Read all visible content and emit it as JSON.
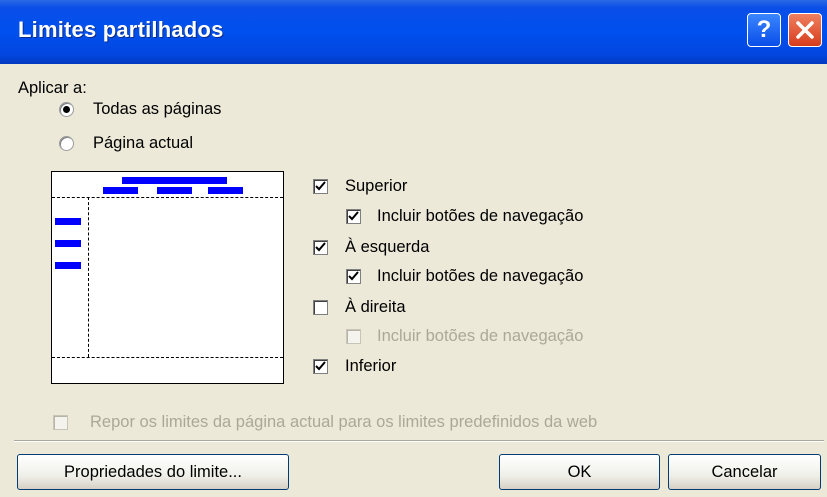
{
  "window": {
    "title": "Limites partilhados",
    "help_label": "?"
  },
  "apply_to": {
    "label": "Aplicar a:",
    "options": [
      {
        "label": "Todas as páginas",
        "selected": true
      },
      {
        "label": "Página actual",
        "selected": false
      }
    ]
  },
  "borders": {
    "top": {
      "label": "Superior",
      "checked": true
    },
    "top_nav": {
      "label": "Incluir botões de navegação",
      "checked": true,
      "enabled": true
    },
    "left": {
      "label": "À esquerda",
      "checked": true
    },
    "left_nav": {
      "label": "Incluir botões de navegação",
      "checked": true,
      "enabled": true
    },
    "right": {
      "label": "À direita",
      "checked": false
    },
    "right_nav": {
      "label": "Incluir botões de navegação",
      "checked": false,
      "enabled": false
    },
    "bottom": {
      "label": "Inferior",
      "checked": true
    }
  },
  "reset": {
    "label": "Repor os limites da página actual para os limites predefinidos da web",
    "checked": false,
    "enabled": false
  },
  "buttons": {
    "properties": "Propriedades do limite...",
    "ok": "OK",
    "cancel": "Cancelar"
  },
  "colors": {
    "title_bar": "#0050ee",
    "preview_bars": "#0000ff",
    "close_button": "#d63c1c"
  }
}
